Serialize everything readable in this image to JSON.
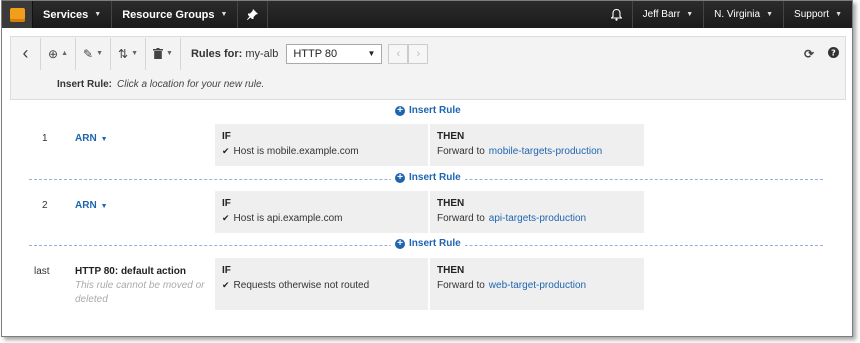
{
  "nav": {
    "services": "Services",
    "resource_groups": "Resource Groups",
    "user": "Jeff Barr",
    "region": "N. Virginia",
    "support": "Support"
  },
  "toolbar": {
    "rules_for_label": "Rules for:",
    "load_balancer": "my-alb",
    "listener_selected": "HTTP 80"
  },
  "banner": {
    "label": "Insert Rule:",
    "hint": "Click a location for your new rule."
  },
  "insert_rule_label": "Insert Rule",
  "rules": [
    {
      "number": "1",
      "name": "ARN",
      "if_header": "IF",
      "condition": "Host is mobile.example.com",
      "then_header": "THEN",
      "action": "Forward to",
      "target": "mobile-targets-production"
    },
    {
      "number": "2",
      "name": "ARN",
      "if_header": "IF",
      "condition": "Host is api.example.com",
      "then_header": "THEN",
      "action": "Forward to",
      "target": "api-targets-production"
    },
    {
      "number": "last",
      "name": "HTTP 80: default action",
      "note": "This rule cannot be moved or deleted",
      "if_header": "IF",
      "condition": "Requests otherwise not routed",
      "then_header": "THEN",
      "action": "Forward to",
      "target": "web-target-production"
    }
  ],
  "colors": {
    "nav_bg": "#1f1f1f",
    "accent_blue": "#1e65b0",
    "cell_bg": "#efefef",
    "logo_orange": "#f19e1c"
  }
}
